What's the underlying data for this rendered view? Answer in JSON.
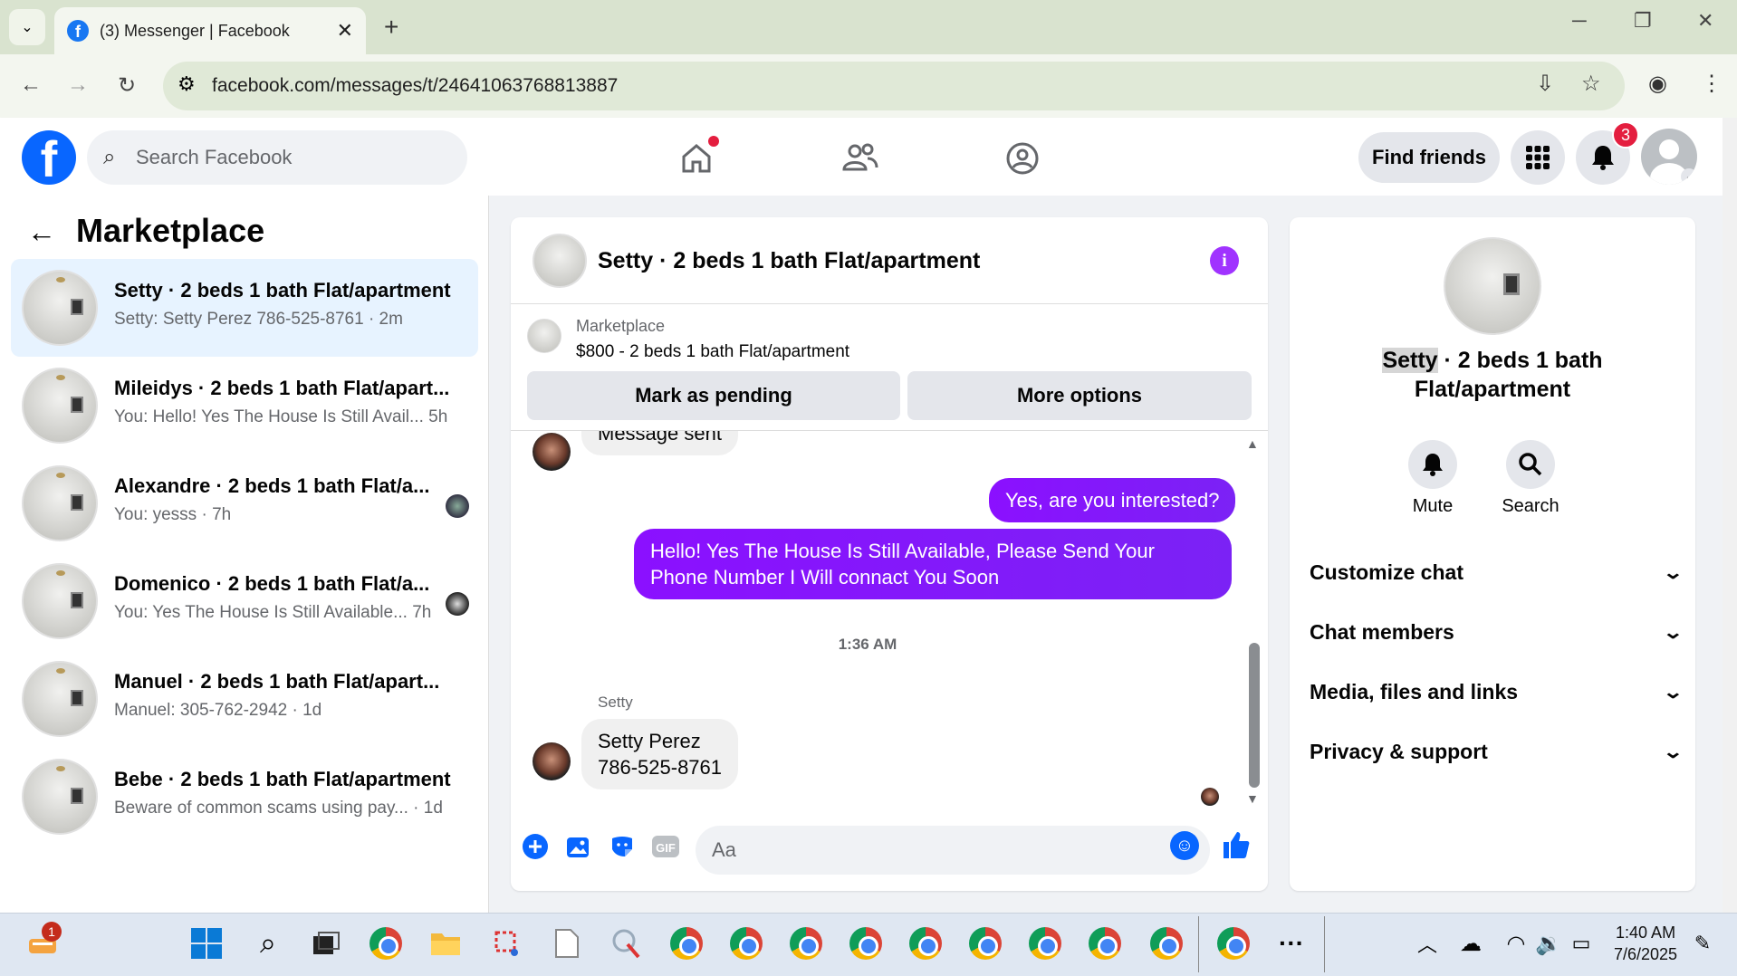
{
  "browser": {
    "tab_title": "(3) Messenger | Facebook",
    "url": "facebook.com/messages/t/24641063768813887"
  },
  "fb": {
    "search_placeholder": "Search Facebook",
    "find_friends": "Find friends",
    "notif_count": "3"
  },
  "left": {
    "title": "Marketplace",
    "conversations": [
      {
        "title": "Setty · 2 beds 1 bath Flat/apartment",
        "preview": "Setty: Setty Perez 786-525-8761 · 2m"
      },
      {
        "title": "Mileidys · 2 beds 1 bath Flat/apart...",
        "preview": "You: Hello! Yes The House Is Still Avail...   5h"
      },
      {
        "title": "Alexandre · 2 beds 1 bath Flat/a...",
        "preview": "You: yesss · 7h"
      },
      {
        "title": "Domenico · 2 beds 1 bath Flat/a...",
        "preview": "You: Yes The House Is Still Available...  7h"
      },
      {
        "title": "Manuel · 2 beds 1 bath Flat/apart...",
        "preview": "Manuel: 305-762-2942 · 1d"
      },
      {
        "title": "Bebe · 2 beds 1 bath Flat/apartment",
        "preview": "Beware of common scams using pay...  · 1d"
      }
    ]
  },
  "chat": {
    "title": "Setty · 2 beds 1 bath Flat/apartment",
    "marketplace_label": "Marketplace",
    "listing": "$800 - 2 beds 1 bath Flat/apartment",
    "mark_pending": "Mark as pending",
    "more_options": "More options",
    "msg_sent": "Message sent",
    "out1": "Yes, are you interested?",
    "out2": "Hello! Yes The House  Is Still Available, Please Send Your Phone Number I Will connact You Soon",
    "timestamp": "1:36 AM",
    "sender": "Setty",
    "in_line1": "Setty Perez",
    "in_line2": "786-525-8761",
    "composer_placeholder": "Aa"
  },
  "right": {
    "name_hl": "Setty",
    "name_rest": " · 2 beds 1 bath",
    "name_line2": "Flat/apartment",
    "mute": "Mute",
    "search": "Search",
    "sections": [
      "Customize chat",
      "Chat members",
      "Media, files and links",
      "Privacy & support"
    ]
  },
  "taskbar": {
    "time": "1:40 AM",
    "date": "7/6/2025",
    "badge": "1"
  },
  "colors": {
    "fb_blue": "#0866ff",
    "purple": "#7a13ff",
    "red": "#e41e3f"
  }
}
